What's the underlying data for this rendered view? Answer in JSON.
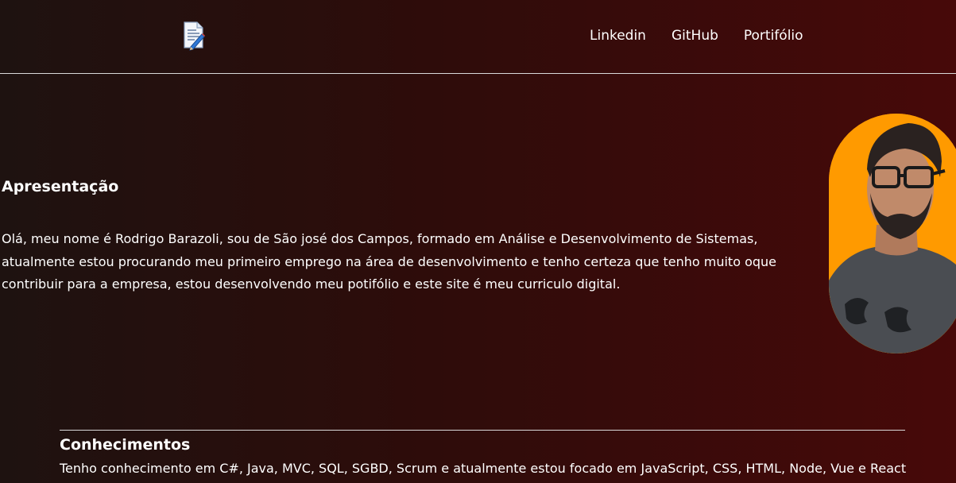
{
  "header": {
    "logo_icon": "document-edit-icon",
    "nav": [
      {
        "label": "Linkedin"
      },
      {
        "label": "GitHub"
      },
      {
        "label": "Portifólio"
      }
    ]
  },
  "intro": {
    "title": "Apresentação",
    "text": "Olá, meu nome é Rodrigo Barazoli, sou de São josé dos Campos, formado em Análise e Desenvolvimento de Sistemas, atualmente estou procurando meu primeiro emprego na área de desenvolvimento e tenho certeza que tenho muito oque contribuir para a empresa, estou desenvolvendo meu potifólio e este site é meu curriculo digital."
  },
  "knowledge": {
    "title": "Conhecimentos",
    "text": "Tenho conhecimento em C#, Java, MVC, SQL, SGBD, Scrum e atualmente estou focado em JavaScript, CSS, HTML, Node, Vue e React"
  },
  "colors": {
    "bg_left": "#1e1210",
    "bg_right": "#470909",
    "avatar_bg": "#ff9a00",
    "text": "#ffffff"
  }
}
